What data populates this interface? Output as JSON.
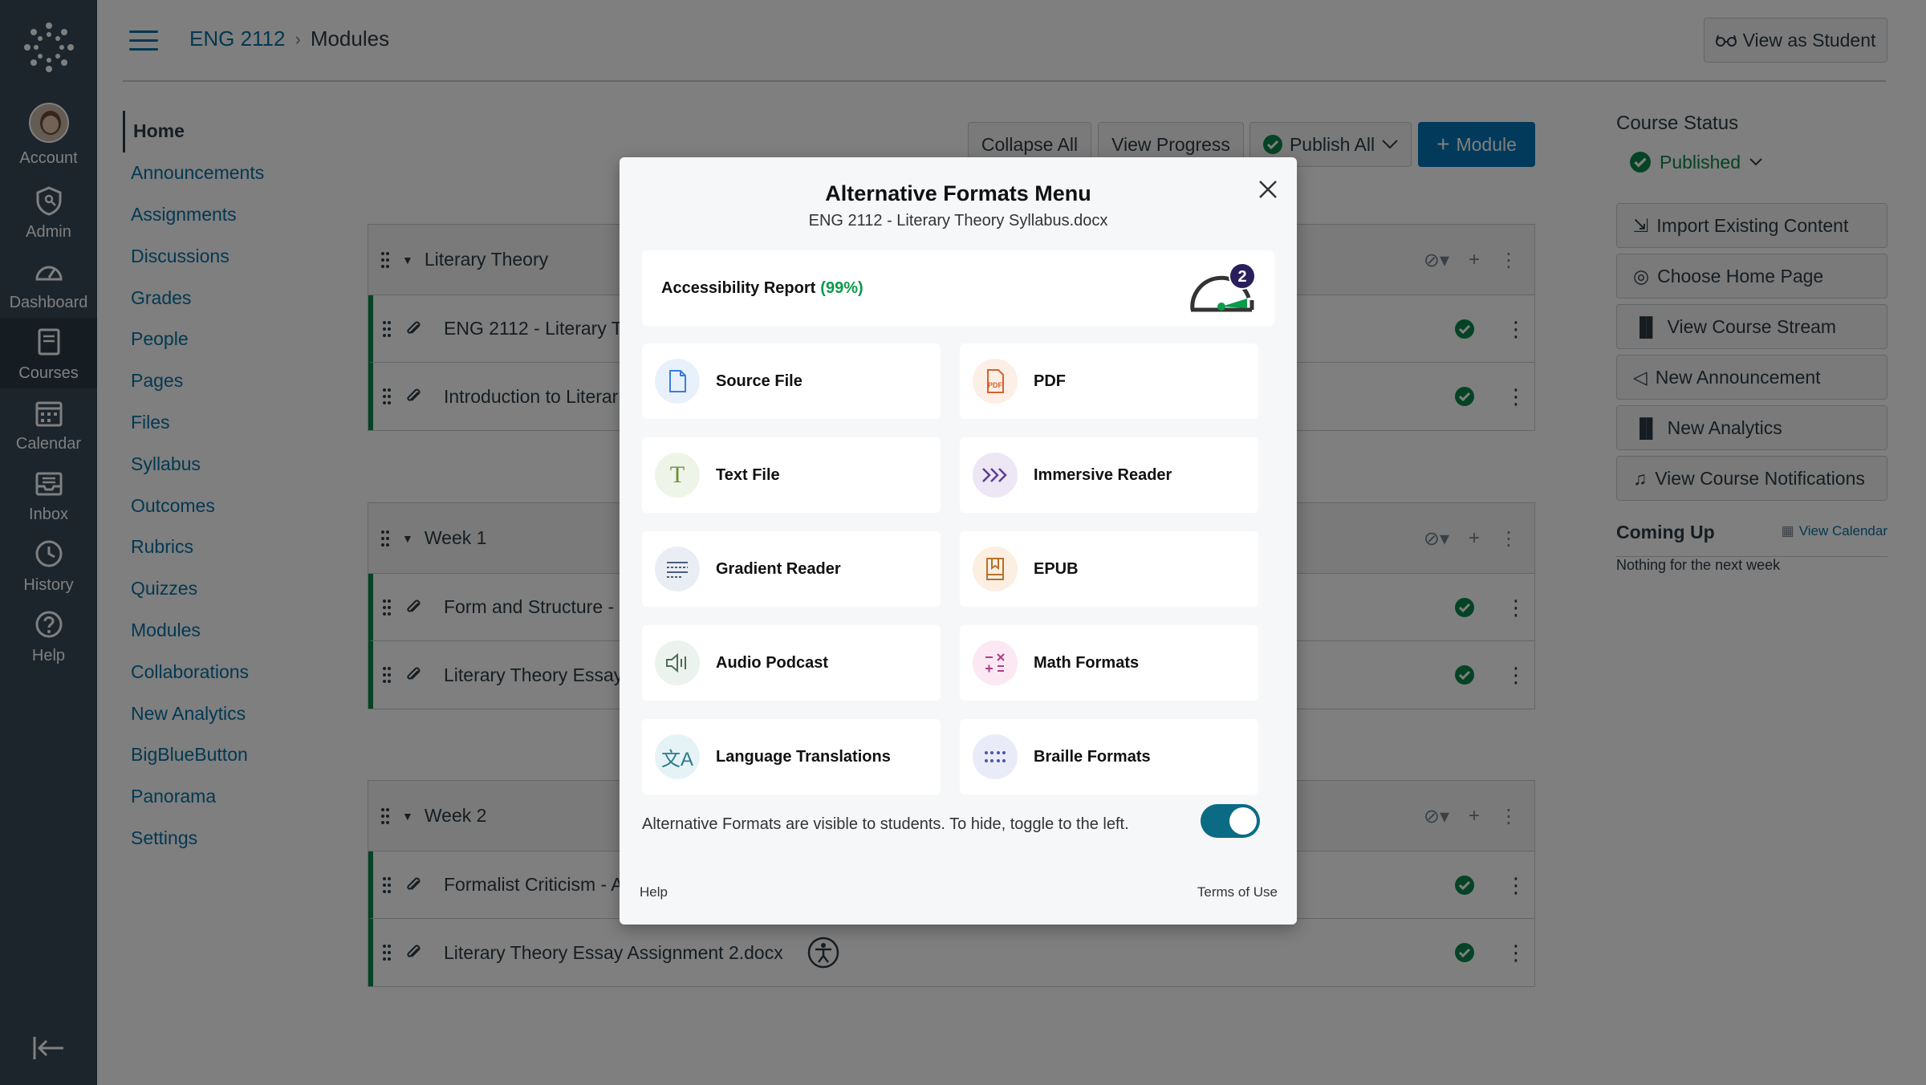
{
  "global_nav": {
    "items": [
      {
        "label": "Account",
        "icon": "avatar"
      },
      {
        "label": "Admin",
        "icon": "shield-icon"
      },
      {
        "label": "Dashboard",
        "icon": "dashboard-icon"
      },
      {
        "label": "Courses",
        "icon": "courses-icon"
      },
      {
        "label": "Calendar",
        "icon": "calendar-icon"
      },
      {
        "label": "Inbox",
        "icon": "inbox-icon"
      },
      {
        "label": "History",
        "icon": "clock-icon"
      },
      {
        "label": "Help",
        "icon": "help-icon"
      }
    ]
  },
  "header": {
    "course": "ENG 2112",
    "page": "Modules",
    "view_as_student": "View as Student"
  },
  "toolbar": {
    "collapse_all": "Collapse All",
    "view_progress": "View Progress",
    "publish_all": "Publish All",
    "add_module": "Module"
  },
  "course_nav": [
    "Home",
    "Announcements",
    "Assignments",
    "Discussions",
    "Grades",
    "People",
    "Pages",
    "Files",
    "Syllabus",
    "Outcomes",
    "Rubrics",
    "Quizzes",
    "Modules",
    "Collaborations",
    "New Analytics",
    "BigBlueButton",
    "Panorama",
    "Settings"
  ],
  "modules": [
    {
      "name": "Literary Theory",
      "items": [
        "ENG 2112 - Literary T",
        "Introduction to Literar"
      ]
    },
    {
      "name": "Week 1",
      "items": [
        "Form and Structure - L",
        "Literary Theory Essay A"
      ]
    },
    {
      "name": "Week 2",
      "items": [
        "Formalist Criticism - A",
        "Literary Theory Essay Assignment 2.docx"
      ]
    }
  ],
  "sidebar": {
    "course_status": "Course Status",
    "published": "Published",
    "buttons": [
      "Import Existing Content",
      "Choose Home Page",
      "View Course Stream",
      "New Announcement",
      "New Analytics",
      "View Course Notifications"
    ],
    "coming_up": "Coming Up",
    "view_calendar": "View Calendar",
    "nothing": "Nothing for the next week"
  },
  "modal": {
    "title": "Alternative Formats Menu",
    "subtitle": "ENG 2112 - Literary Theory Syllabus.docx",
    "report_label": "Accessibility Report",
    "report_pct": "(99%)",
    "gauge_badge": "2",
    "formats": [
      {
        "label": "Source File",
        "icon": "file-icon",
        "color": "#e8f1fb"
      },
      {
        "label": "PDF",
        "icon": "pdf-icon",
        "color": "#fdeee6"
      },
      {
        "label": "Text File",
        "icon": "text-icon",
        "color": "#eef5e8"
      },
      {
        "label": "Immersive Reader",
        "icon": "immersive-reader-icon",
        "color": "#ece6f5"
      },
      {
        "label": "Gradient Reader",
        "icon": "gradient-reader-icon",
        "color": "#eaeef4"
      },
      {
        "label": "EPUB",
        "icon": "epub-icon",
        "color": "#fcefe2"
      },
      {
        "label": "Audio Podcast",
        "icon": "speaker-icon",
        "color": "#ecf3ee"
      },
      {
        "label": "Math Formats",
        "icon": "math-icon",
        "color": "#fbe8f3"
      },
      {
        "label": "Language Translations",
        "icon": "translate-icon",
        "color": "#e6f3f6"
      },
      {
        "label": "Braille Formats",
        "icon": "braille-icon",
        "color": "#e9ecf8"
      }
    ],
    "visible_text": "Alternative Formats are visible to students. To hide, toggle to the left.",
    "toggle_on": true,
    "help": "Help",
    "terms": "Terms of Use"
  }
}
